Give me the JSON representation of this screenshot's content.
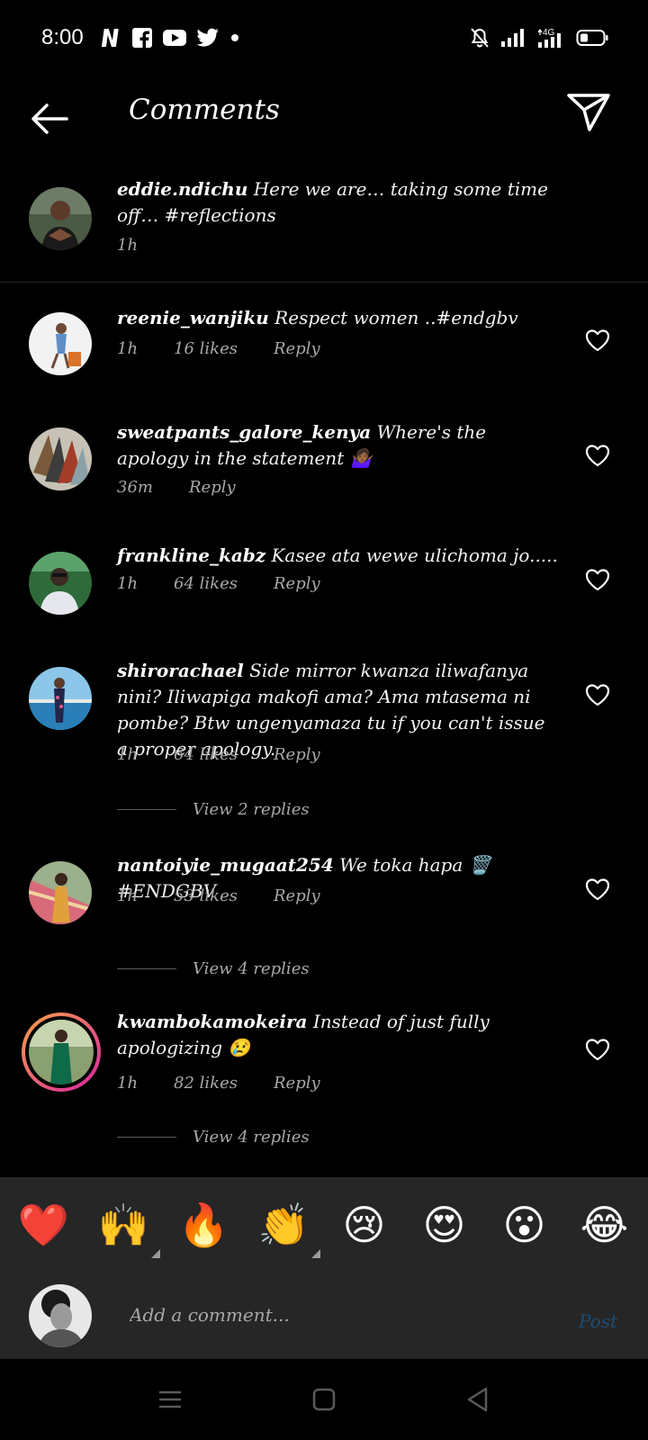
{
  "status_bar": {
    "time": "8:00",
    "app_icons": [
      "netflix-icon",
      "facebook-icon",
      "youtube-icon",
      "twitter-icon",
      "notification-dot-icon"
    ],
    "network": "4G",
    "right_icons": [
      "silent-icon",
      "signal-icon",
      "signal-4g-icon",
      "battery-icon"
    ]
  },
  "header": {
    "title": "Comments",
    "back_icon": "back-arrow-icon",
    "share_icon": "send-icon"
  },
  "caption": {
    "username": "eddie.ndichu",
    "text": "Here we are… taking some time off… #reflections",
    "time": "1h"
  },
  "comments": [
    {
      "username": "reenie_wanjiku",
      "text": "Respect women ..#endgbv",
      "time": "1h",
      "likes": "16 likes",
      "reply_label": "Reply"
    },
    {
      "username": "sweatpants_galore_kenya",
      "text": "Where's the apology in the statement 🤷🏾‍♀️",
      "time": "36m",
      "likes": "",
      "reply_label": "Reply"
    },
    {
      "username": "frankline_kabz",
      "text": "Kasee ata wewe ulichoma jo.....",
      "time": "1h",
      "likes": "64 likes",
      "reply_label": "Reply"
    },
    {
      "username": "shirorachael",
      "text": "Side mirror kwanza iliwafanya nini? Iliwapiga makofi ama? Ama mtasema ni pombe? Btw ungenyamaza tu if you can't issue a proper apology.",
      "time": "1h",
      "likes": "64 likes",
      "reply_label": "Reply",
      "view_replies": "View 2 replies"
    },
    {
      "username": "nantoiyie_mugaat254",
      "text": "We toka hapa 🗑️#ENDGBV",
      "time": "1h",
      "likes": "53 likes",
      "reply_label": "Reply",
      "view_replies": "View 4 replies"
    },
    {
      "username": "kwambokamokeira",
      "text": "Instead of just fully apologizing 😢",
      "time": "1h",
      "likes": "82 likes",
      "reply_label": "Reply",
      "view_replies": "View 4 replies"
    }
  ],
  "emoji_bar": [
    "❤️",
    "🙌",
    "🔥",
    "👏",
    "😢",
    "😍",
    "😮",
    "😂"
  ],
  "comment_input": {
    "placeholder": "Add a comment...",
    "post_label": "Post"
  },
  "colors": {
    "background": "#000000",
    "panel": "#262626",
    "secondary_text": "#a8a8a8",
    "post_disabled": "#1e4d75",
    "story_ring_start": "#f9a34a",
    "story_ring_end": "#d6249f"
  }
}
